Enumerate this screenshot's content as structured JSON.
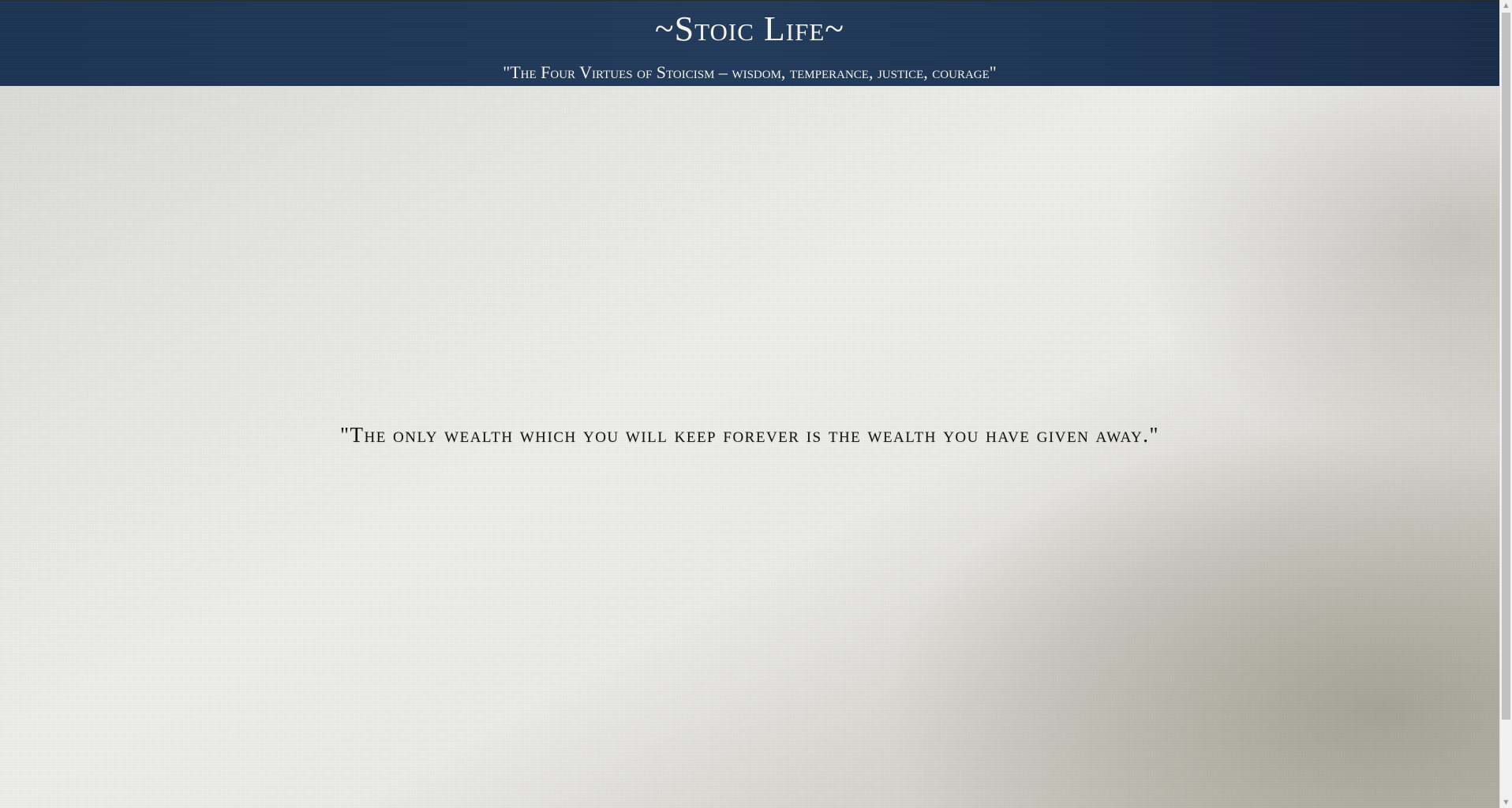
{
  "header": {
    "title": "~Stoic Life~",
    "subtitle": "\"The Four Virtues of Stoicism – wisdom, temperance, justice, courage\""
  },
  "main": {
    "quote": "\"The only wealth which you will keep forever is the wealth you have given away.\""
  },
  "scrollbar": {
    "up_icon": "▲",
    "down_icon": "▼"
  },
  "colors": {
    "header_background": "#1f385a",
    "header_text": "#f4f2ea",
    "quote_text": "#141414",
    "page_background": "#e6e6e4"
  }
}
